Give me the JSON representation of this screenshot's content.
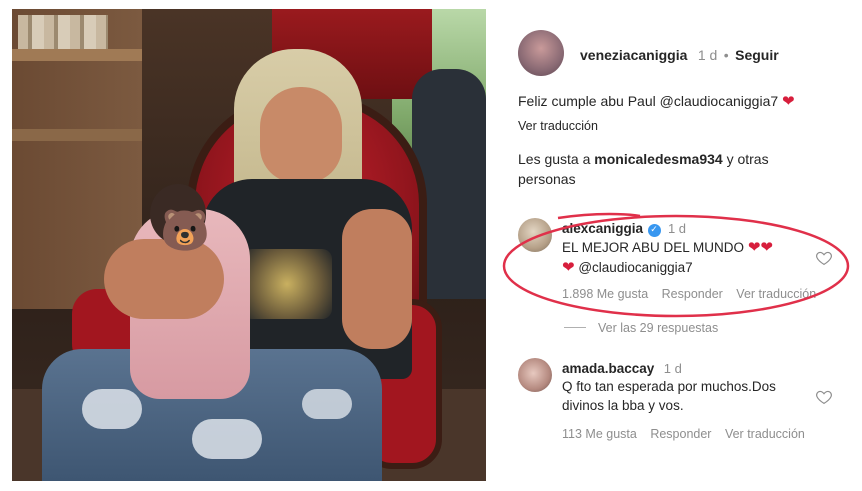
{
  "post": {
    "username": "veneziacaniggia",
    "time": "1 d",
    "separator": "•",
    "follow": "Seguir",
    "caption_text": "Feliz cumple abu Paul",
    "caption_mention": "@claudiocaniggia7",
    "caption_emoji": "❤",
    "translate": "Ver traducción",
    "likes_prefix": "Les gusta a",
    "likes_user": "monicaledesma934",
    "likes_suffix_1": "y otras",
    "likes_suffix_2": "personas"
  },
  "comments": [
    {
      "username": "alexcaniggia",
      "verified_glyph": "✓",
      "time": "1 d",
      "text_line1": "EL MEJOR ABU DEL MUNDO",
      "emoji_line1": "❤❤",
      "emoji_line2": "❤",
      "mention": "@claudiocaniggia7",
      "likes": "1.898 Me gusta",
      "reply": "Responder",
      "translate": "Ver traducción",
      "view_replies": "Ver las 29 respuestas"
    },
    {
      "username": "amada.baccay",
      "time": "1 d",
      "text_line1": "Q fto tan esperada por muchos.Dos",
      "text_line2": "divinos la bba y vos.",
      "likes": "113 Me gusta",
      "reply": "Responder",
      "translate": "Ver traducción"
    }
  ],
  "photo": {
    "overlay_emoji": "🐻"
  },
  "colors": {
    "heart": "#d71e3c",
    "verified": "#3897f0",
    "highlight_ring": "#e0304a"
  }
}
